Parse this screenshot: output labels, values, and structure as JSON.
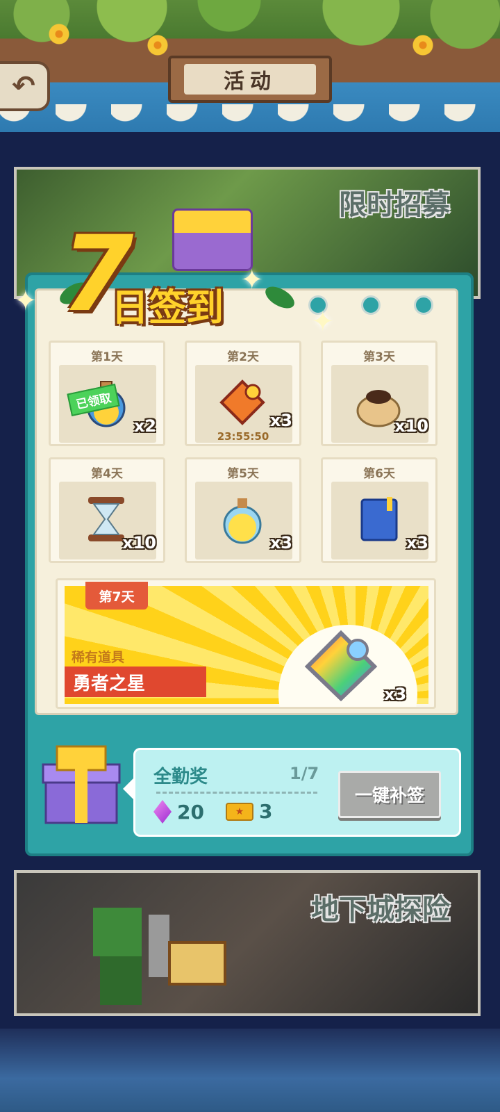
{
  "header": {
    "title": "活动",
    "back_icon": "back-arrow-icon"
  },
  "banners": {
    "recruit_label": "限时招募",
    "dungeon_label": "地下城探险"
  },
  "signin": {
    "logo_number": "7",
    "logo_text": "日签到",
    "days": [
      {
        "label": "第1天",
        "qty": "x2",
        "icon": "potion-icon",
        "status": "已领取"
      },
      {
        "label": "第2天",
        "qty": "x3",
        "icon": "puzzle-piece-icon",
        "timer": "23:55:50"
      },
      {
        "label": "第3天",
        "qty": "x10",
        "icon": "coffee-bag-icon"
      },
      {
        "label": "第4天",
        "qty": "x10",
        "icon": "hourglass-icon"
      },
      {
        "label": "第5天",
        "qty": "x3",
        "icon": "yellow-potion-icon"
      },
      {
        "label": "第6天",
        "qty": "x3",
        "icon": "blue-book-icon"
      }
    ],
    "day7": {
      "label": "第7天",
      "category": "稀有道具",
      "name": "勇者之星",
      "qty": "x3",
      "icon": "rainbow-puzzle-icon"
    }
  },
  "attendance": {
    "title": "全勤奖",
    "progress": "1/7",
    "rewards": [
      {
        "icon": "gem-icon",
        "value": "20"
      },
      {
        "icon": "ticket-icon",
        "value": "3"
      }
    ],
    "button_label": "一键补签"
  },
  "colors": {
    "panel": "#2ea3a6",
    "paper": "#f6f0dc",
    "accent_red": "#e0482f",
    "gold": "#ffd22b"
  }
}
